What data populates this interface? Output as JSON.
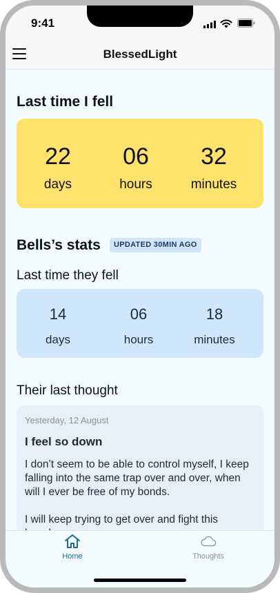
{
  "status_bar": {
    "time": "9:41",
    "icons": [
      "cellular-signal-icon",
      "wifi-icon",
      "battery-icon"
    ]
  },
  "header": {
    "title": "BlessedLight",
    "menu_icon": "hamburger-menu-icon"
  },
  "my_counter": {
    "heading": "Last time I fell",
    "days": "22",
    "days_label": "days",
    "hours": "06",
    "hours_label": "hours",
    "minutes": "32",
    "minutes_label": "minutes",
    "color": "#fde36b"
  },
  "friend": {
    "heading": "Bells’s stats",
    "badge": "UPDATED 30MIN AGO",
    "subheading": "Last time they fell",
    "days": "14",
    "days_label": "days",
    "hours": "06",
    "hours_label": "hours",
    "minutes": "18",
    "minutes_label": "minutes",
    "color": "#cfe6fb"
  },
  "thought": {
    "heading": "Their last thought",
    "date": "Yesterday, 12 August",
    "title": "I feel so down",
    "paragraph1": "I don’t seem to be able to control myself, I keep falling into the same trap over and over, when will I ever be free of my bonds.",
    "paragraph2": "I will keep trying to get over and fight this hopelessness."
  },
  "tabs": [
    {
      "label": "Home",
      "icon": "home-icon",
      "active": true,
      "color": "#1a6a8f"
    },
    {
      "label": "Thoughts",
      "icon": "cloud-icon",
      "active": false,
      "color": "#8a8f98"
    }
  ]
}
